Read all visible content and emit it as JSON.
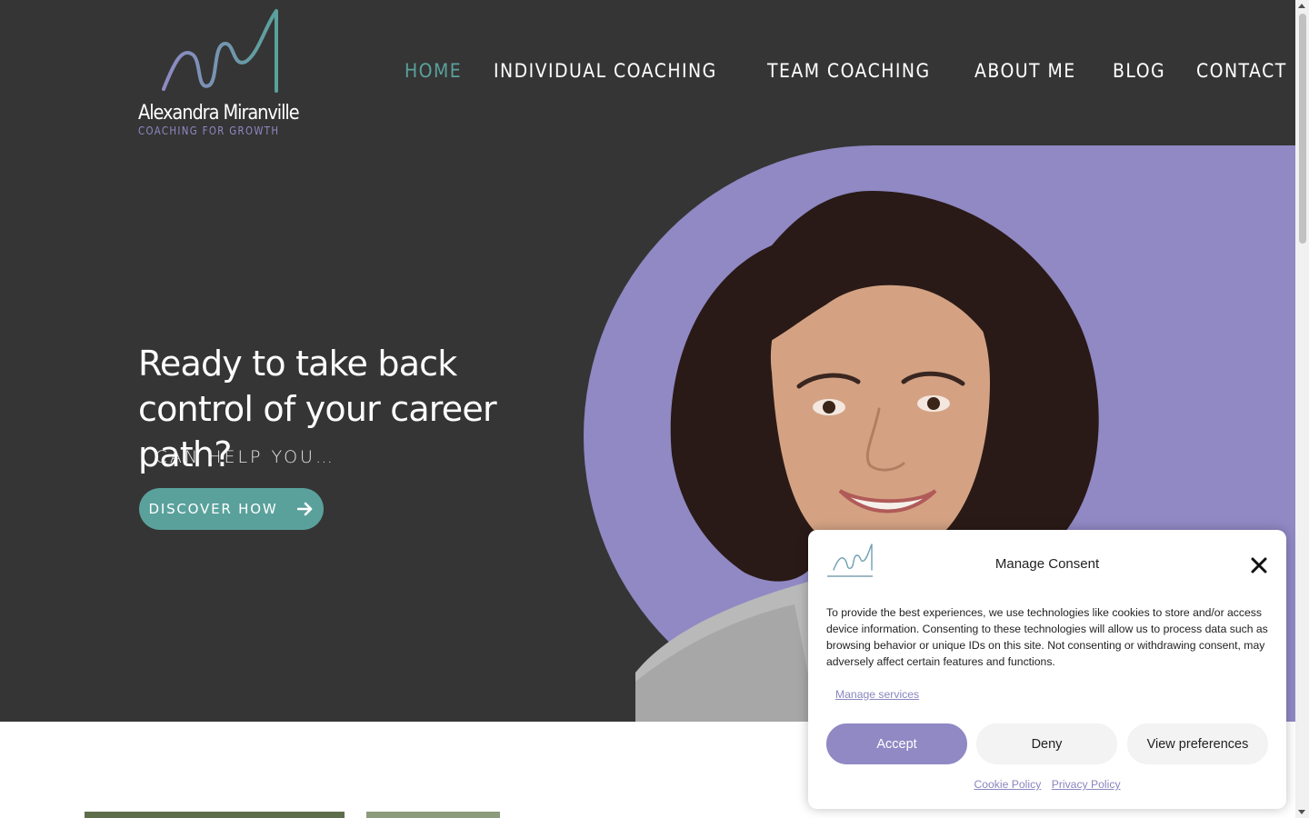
{
  "brand": {
    "name": "Alexandra Miranville",
    "tagline": "COACHING FOR GROWTH",
    "colors": {
      "background": "#353535",
      "accent_teal": "#5aa19c",
      "accent_purple": "#9089c4"
    }
  },
  "nav": {
    "items": [
      {
        "label": "HOME",
        "active": true
      },
      {
        "label": "INDIVIDUAL COACHING"
      },
      {
        "label": "TEAM COACHING"
      },
      {
        "label": "ABOUT ME"
      },
      {
        "label": "BLOG"
      },
      {
        "label": "CONTACT"
      }
    ]
  },
  "hero": {
    "headline": "Ready to take back control of your career path?",
    "subheading": "I CAN HELP YOU…",
    "cta_label": "DISCOVER HOW",
    "cta_icon": "arrow-right-icon"
  },
  "consent": {
    "title": "Manage Consent",
    "close_icon": "close-icon",
    "body": "To provide the best experiences, we use technologies like cookies to store and/or access device information. Consenting to these technologies will allow us to process data such as browsing behavior or unique IDs on this site. Not consenting or withdrawing consent, may adversely affect certain features and functions.",
    "manage_services": "Manage services",
    "accept": "Accept",
    "deny": "Deny",
    "view_preferences": "View preferences",
    "cookie_policy": "Cookie Policy",
    "privacy_policy": "Privacy Policy"
  }
}
